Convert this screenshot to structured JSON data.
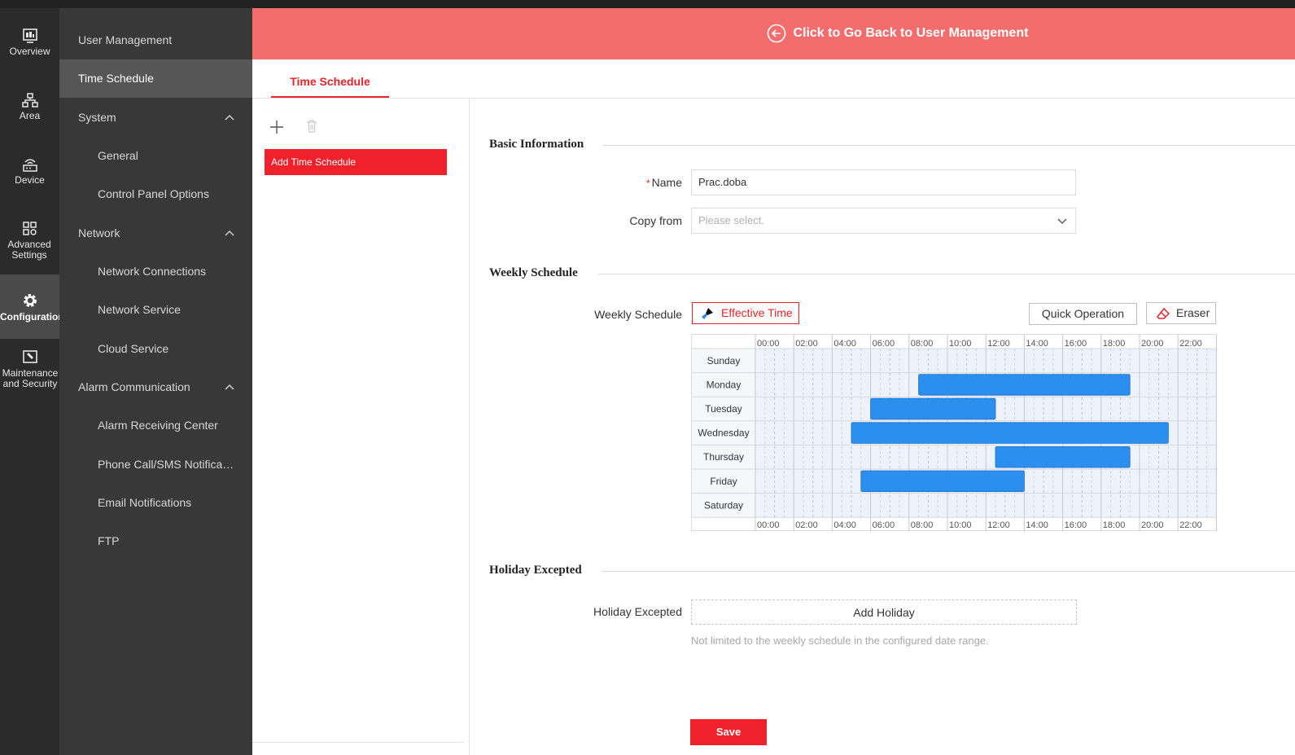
{
  "rail": [
    {
      "label": "Overview",
      "icon": "overview-icon"
    },
    {
      "label": "Area",
      "icon": "area-icon"
    },
    {
      "label": "Device",
      "icon": "device-icon"
    },
    {
      "label": "Advanced Settings",
      "icon": "advanced-settings-icon"
    },
    {
      "label": "Configuration",
      "icon": "gear-icon",
      "active": true
    },
    {
      "label": "Maintenance and Security",
      "icon": "maintenance-icon"
    }
  ],
  "subnav": {
    "user_management": "User Management",
    "time_schedule": "Time Schedule",
    "system": "System",
    "general": "General",
    "control_panel_options": "Control Panel Options",
    "network": "Network",
    "network_connections": "Network Connections",
    "network_service": "Network Service",
    "cloud_service": "Cloud Service",
    "alarm_communication": "Alarm Communication",
    "alarm_receiving_center": "Alarm Receiving Center",
    "phone_call_sms": "Phone Call/SMS Notifica…",
    "email_notifications": "Email Notifications",
    "ftp": "FTP"
  },
  "banner": {
    "text": "Click to Go Back to User Management"
  },
  "tab": {
    "label": "Time Schedule"
  },
  "list": {
    "item": "Add Time Schedule"
  },
  "basic_info": {
    "heading": "Basic Information",
    "name_label": "Name",
    "name_value": "Prac.doba",
    "copy_from_label": "Copy from",
    "copy_from_placeholder": "Please select."
  },
  "weekly": {
    "heading": "Weekly Schedule",
    "label": "Weekly Schedule",
    "effective_time": "Effective Time",
    "quick_operation": "Quick Operation",
    "eraser": "Eraser",
    "hour_labels": [
      "00:00",
      "02:00",
      "04:00",
      "06:00",
      "08:00",
      "10:00",
      "12:00",
      "14:00",
      "16:00",
      "18:00",
      "20:00",
      "22:00"
    ],
    "days": [
      "Sunday",
      "Monday",
      "Tuesday",
      "Wednesday",
      "Thursday",
      "Friday",
      "Saturday"
    ],
    "segment_color": "#2b8ff0",
    "segments": [
      {
        "day": "Monday",
        "start": "08:30",
        "end": "19:30"
      },
      {
        "day": "Tuesday",
        "start": "06:00",
        "end": "12:30"
      },
      {
        "day": "Wednesday",
        "start": "05:00",
        "end": "21:30"
      },
      {
        "day": "Thursday",
        "start": "12:30",
        "end": "19:30"
      },
      {
        "day": "Friday",
        "start": "05:30",
        "end": "14:00"
      }
    ]
  },
  "holiday": {
    "heading": "Holiday Excepted",
    "label": "Holiday Excepted",
    "add_button": "Add Holiday",
    "hint": "Not limited to the weekly schedule in the configured date range."
  },
  "save": "Save"
}
